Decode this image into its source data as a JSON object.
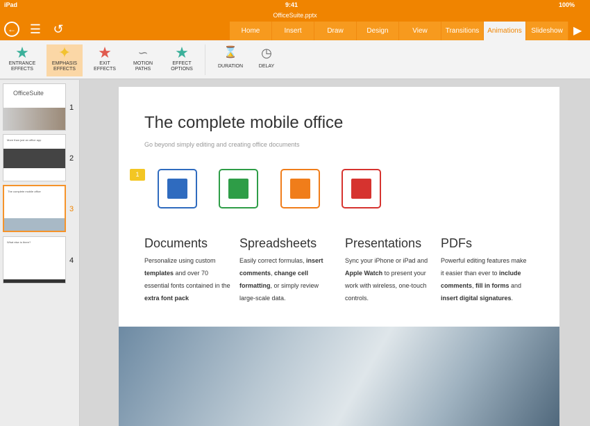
{
  "status": {
    "device": "iPad",
    "time": "9:41",
    "battery": "100%"
  },
  "document": {
    "title": "OfficeSuite.pptx"
  },
  "tabs": [
    "Home",
    "Insert",
    "Draw",
    "Design",
    "View",
    "Transitions",
    "Animations",
    "Slideshow"
  ],
  "ribbon": [
    {
      "l1": "ENTRANCE",
      "l2": "EFFECTS"
    },
    {
      "l1": "EMPHASIS",
      "l2": "EFFECTS"
    },
    {
      "l1": "EXIT",
      "l2": "EFFECTS"
    },
    {
      "l1": "MOTION",
      "l2": "PATHS"
    },
    {
      "l1": "EFFECT",
      "l2": "OPTIONS"
    },
    {
      "l1": "DURATION",
      "l2": ""
    },
    {
      "l1": "DELAY",
      "l2": ""
    }
  ],
  "thumbnails": [
    "1",
    "2",
    "3",
    "4"
  ],
  "thumb_text": {
    "logo": "OfficeSuite",
    "t2": "More than just an office app",
    "t3": "The complete mobile office",
    "t4": "What else is there?"
  },
  "slide": {
    "title": "The complete mobile office",
    "subtitle": "Go beyond simply editing and creating office documents",
    "badge": "1",
    "columns": [
      {
        "heading": "Documents",
        "segs": [
          [
            "Personalize using custom ",
            0
          ],
          [
            "templates",
            1
          ],
          [
            " and over 70 essential fonts contained in the ",
            0
          ],
          [
            "extra font pack",
            1
          ]
        ]
      },
      {
        "heading": "Spreadsheets",
        "segs": [
          [
            "Easily correct formulas, ",
            0
          ],
          [
            "insert comments",
            1
          ],
          [
            ", ",
            0
          ],
          [
            "change cell formatting",
            1
          ],
          [
            ", or simply review large-scale data.",
            0
          ]
        ]
      },
      {
        "heading": "Presentations",
        "segs": [
          [
            "Sync your iPhone or iPad and ",
            0
          ],
          [
            "Apple Watch",
            1
          ],
          [
            " to present your work with wireless, one-touch controls.",
            0
          ]
        ]
      },
      {
        "heading": "PDFs",
        "segs": [
          [
            "Powerful editing features make it easier than ever to ",
            0
          ],
          [
            "include comments",
            1
          ],
          [
            ", ",
            0
          ],
          [
            "fill in forms",
            1
          ],
          [
            " and ",
            0
          ],
          [
            "insert digital signatures",
            1
          ],
          [
            ".",
            0
          ]
        ]
      }
    ]
  },
  "colors": {
    "accent": "#f08400",
    "doc": "#2f6bbf",
    "sheet": "#2e9d47",
    "pres": "#f07d1a",
    "pdf": "#d6332f"
  }
}
